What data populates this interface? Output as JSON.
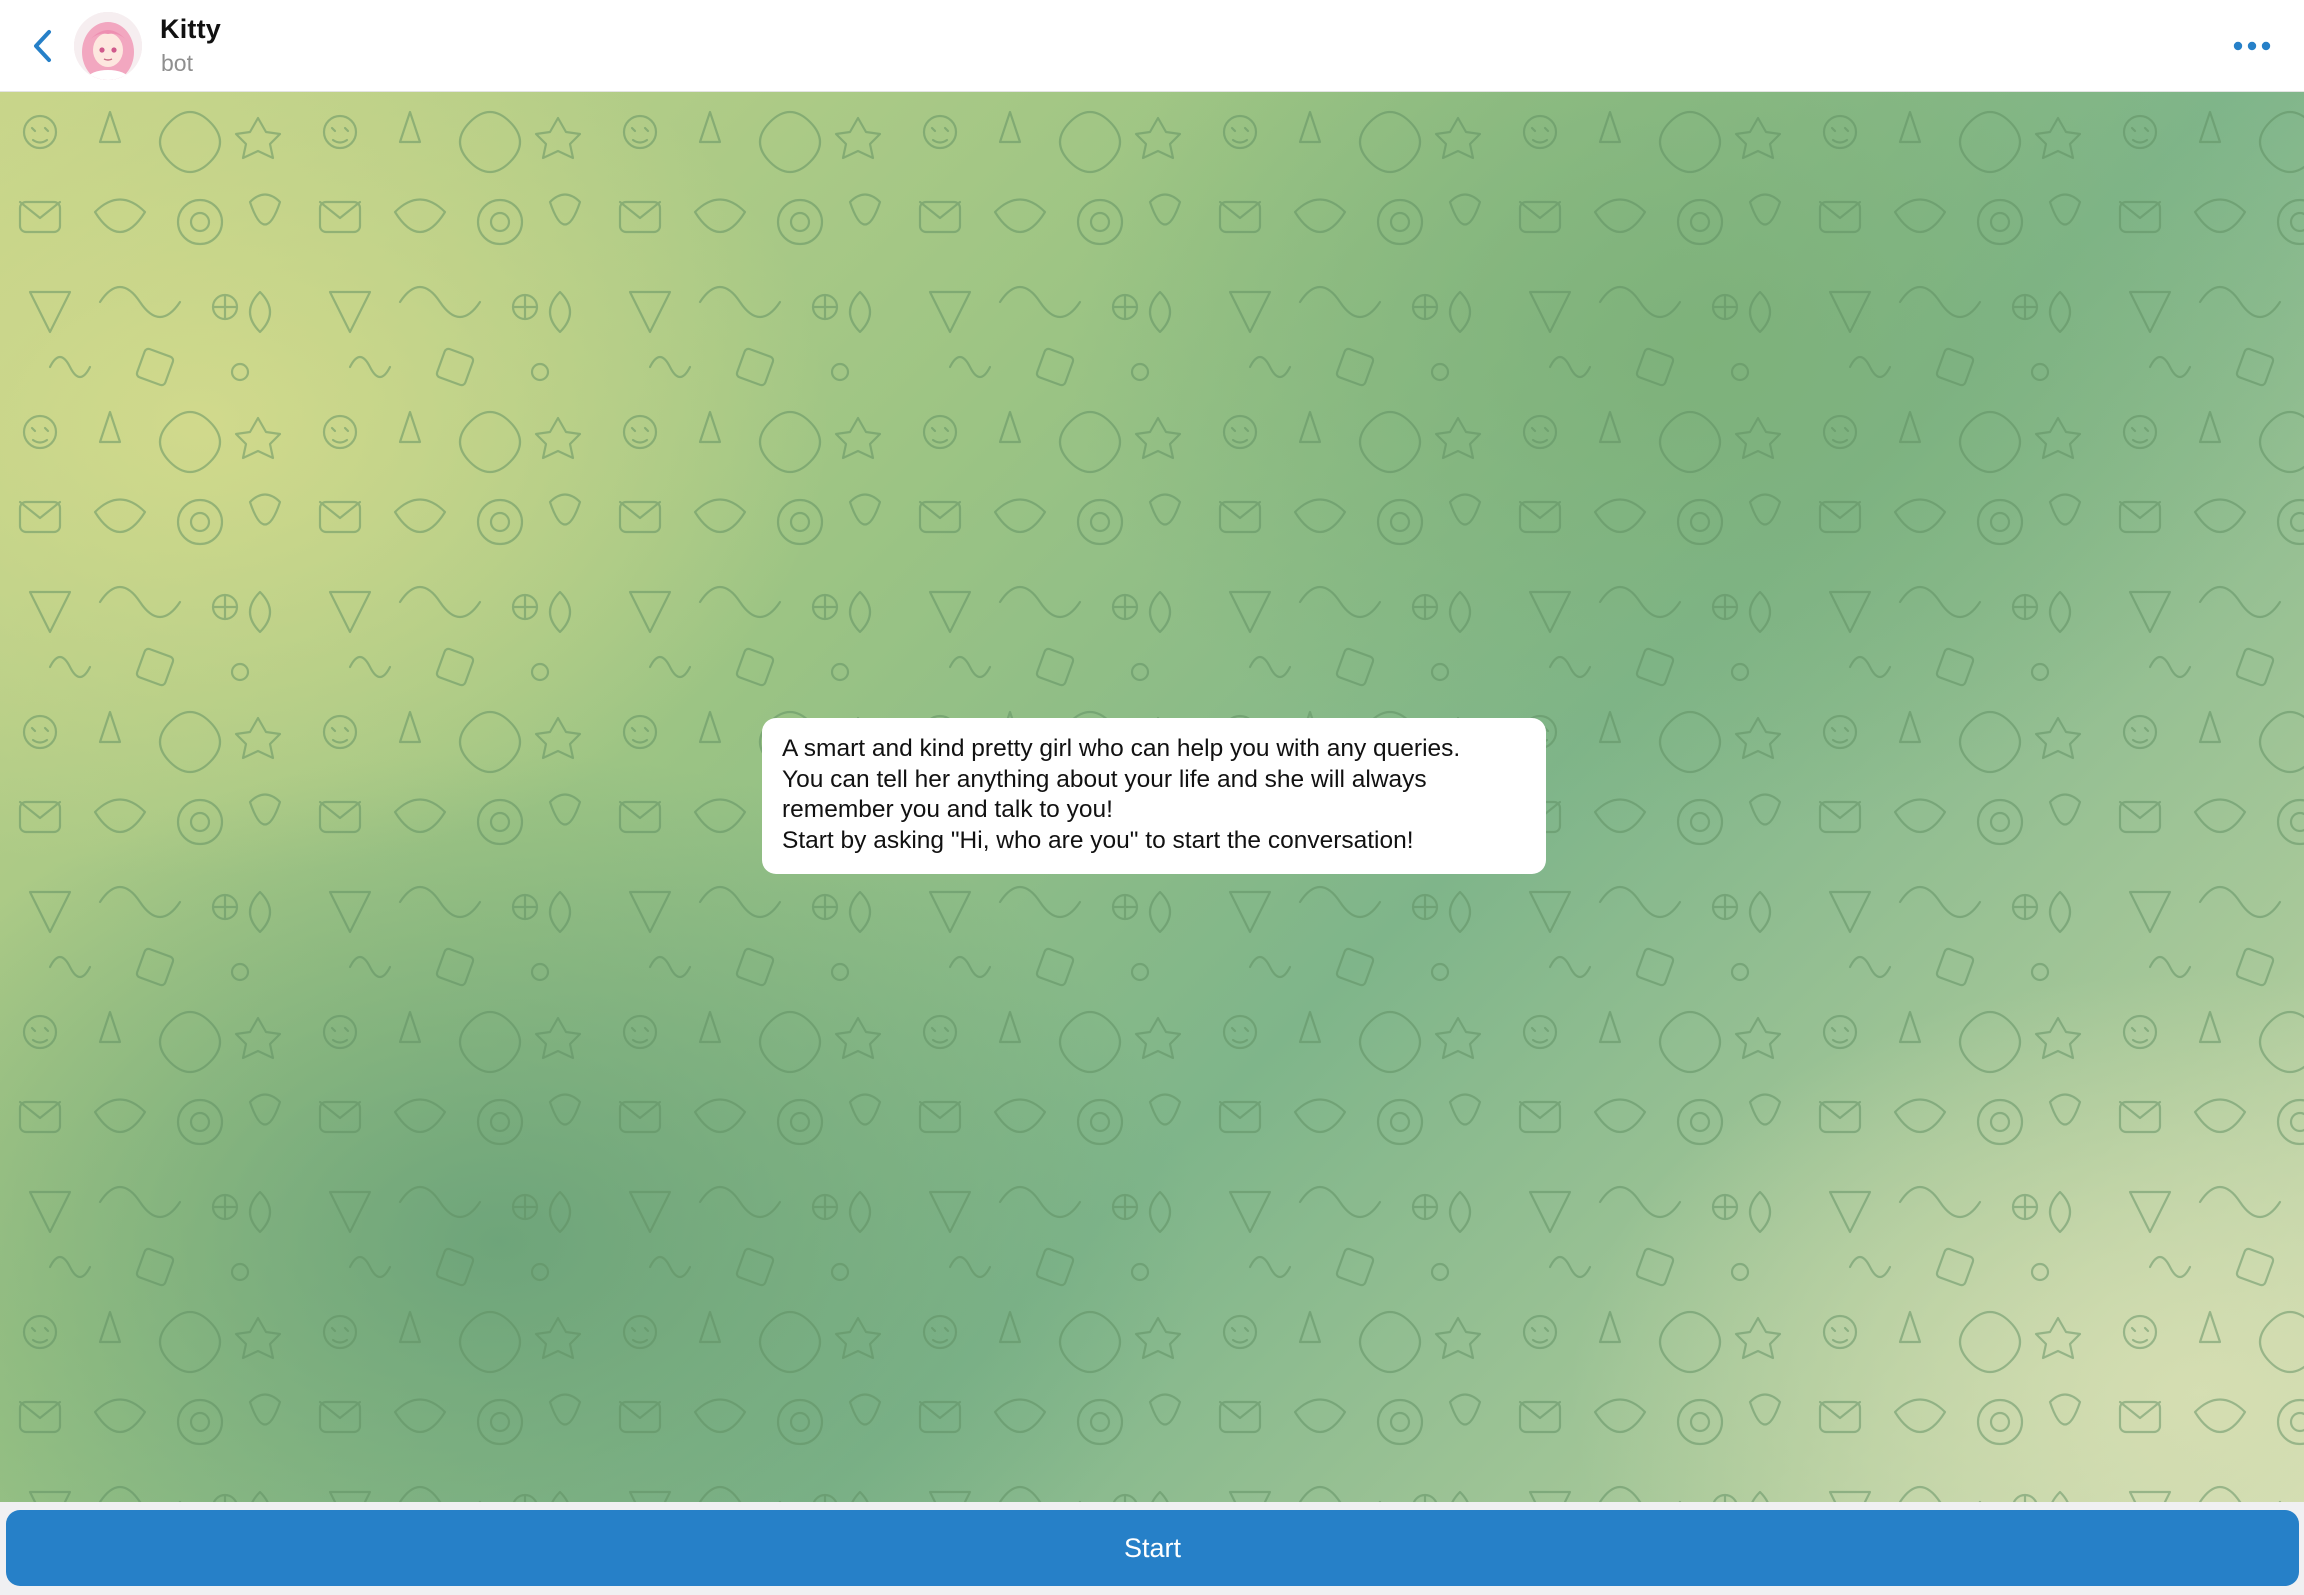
{
  "header": {
    "title": "Kitty",
    "subtitle": "bot",
    "back_icon": "chevron-left-icon",
    "more_icon": "more-horizontal-icon",
    "accent_color": "#2680c8"
  },
  "chat": {
    "intro_lines": [
      "A smart and kind pretty girl who can help you with any queries.",
      "You can tell her anything about your life and she will always",
      "remember you and talk to you!",
      "Start by asking \"Hi, who are you\" to start the conversation!"
    ]
  },
  "bottom": {
    "start_label": "Start",
    "button_color": "#2680c8"
  }
}
